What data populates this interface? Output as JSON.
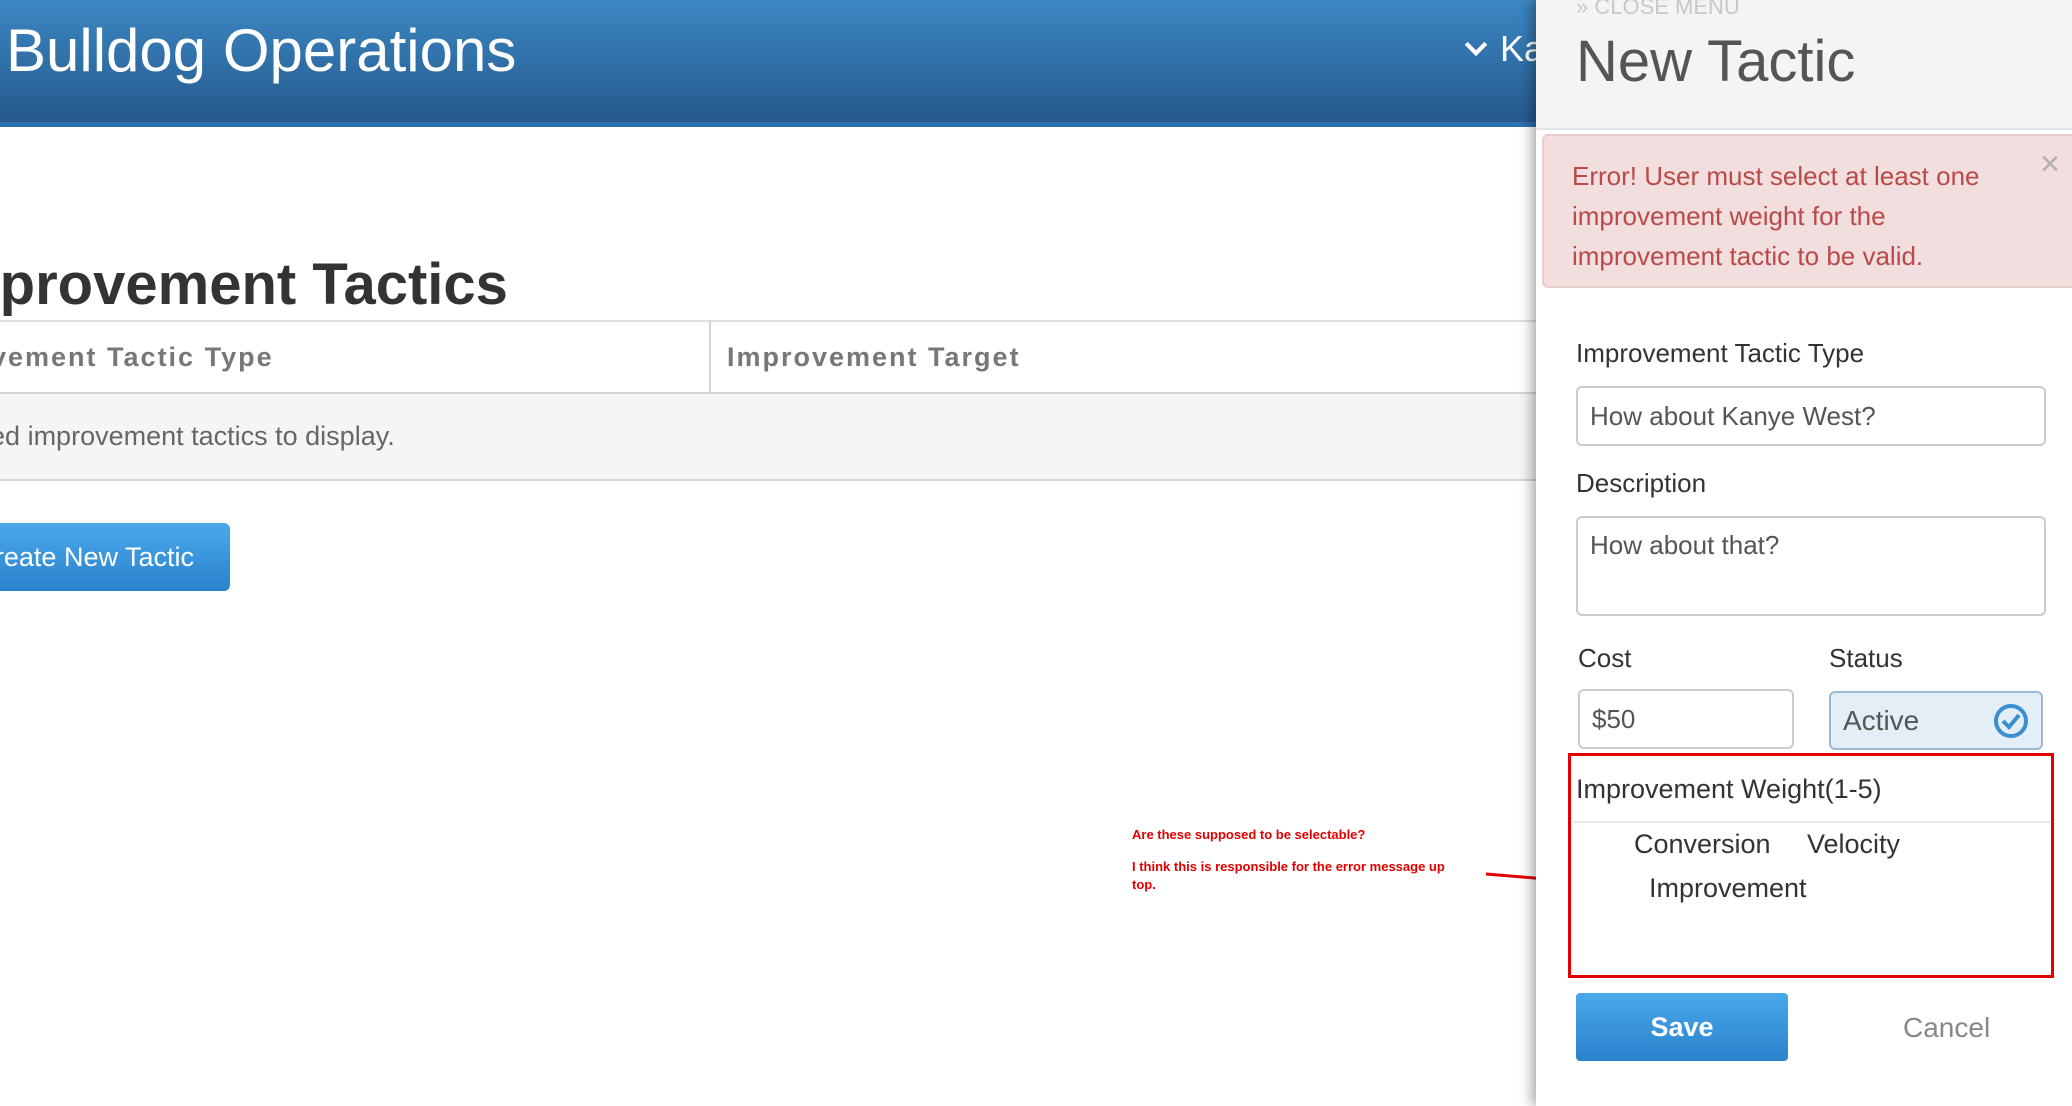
{
  "header": {
    "app_title": "Bulldog Operations",
    "user_name": "Ka"
  },
  "main": {
    "page_heading": "Improvement Tactics",
    "table": {
      "columns": [
        "Improvement Tactic Type",
        "Improvement Target"
      ],
      "empty_message": "No saved improvement tactics to display."
    },
    "create_button_label": "Create New Tactic"
  },
  "annotation": {
    "line1": "Are these supposed to be selectable?",
    "line2": "I think this is responsible for the error message up top."
  },
  "panel": {
    "close_menu_label": "» CLOSE MENU",
    "title": "New Tactic",
    "error": {
      "prefix": "Error!",
      "message": "User must select at least one improvement weight for the improvement tactic to be valid.",
      "close_symbol": "×"
    },
    "tactic_type": {
      "label": "Improvement Tactic Type",
      "value": "How about Kanye West?"
    },
    "description": {
      "label": "Description",
      "value": "How about that?"
    },
    "cost": {
      "label": "Cost",
      "value": "$50"
    },
    "status": {
      "label": "Status",
      "value": "Active"
    },
    "improvement_weight": {
      "label": "Improvement Weight(1-5)",
      "columns": [
        "Conversion",
        "Velocity",
        "Improvement"
      ]
    },
    "save_label": "Save",
    "cancel_label": "Cancel"
  },
  "colors": {
    "header_blue": "#2f73ad",
    "button_blue": "#3592db",
    "error_bg": "#f2dede",
    "error_text": "#b94a48",
    "annotation_red": "#e30000"
  },
  "icons": [
    "chevron-down-icon",
    "check-circle-icon",
    "close-icon",
    "arrow-icon"
  ]
}
